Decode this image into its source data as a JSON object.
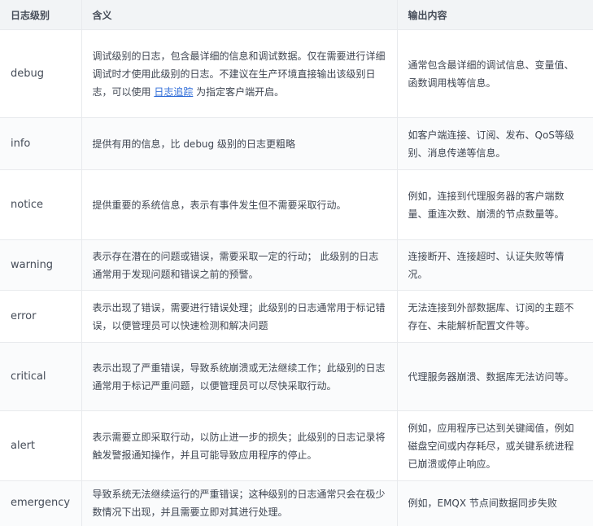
{
  "headers": [
    "日志级别",
    "含义",
    "输出内容"
  ],
  "rows": [
    {
      "level": "debug",
      "meaning_pre": "调试级别的日志，包含最详细的信息和调试数据。仅在需要进行详细调试时才使用此级别的日志。不建议在生产环境直接输出该级别日志，可以使用 ",
      "meaning_link": "日志追踪",
      "meaning_post": " 为指定客户端开启。",
      "output": "通常包含最详细的调试信息、变量值、函数调用栈等信息。"
    },
    {
      "level": "info",
      "meaning": "提供有用的信息，比 debug 级别的日志更粗略",
      "output": "如客户端连接、订阅、发布、QoS等级别、消息传递等信息。"
    },
    {
      "level": "notice",
      "meaning": "提供重要的系统信息，表示有事件发生但不需要采取行动。",
      "output": "例如，连接到代理服务器的客户端数量、重连次数、崩溃的节点数量等。"
    },
    {
      "level": "warning",
      "meaning": "表示存在潜在的问题或错误，需要采取一定的行动； 此级别的日志通常用于发现问题和错误之前的预警。",
      "output": "连接断开、连接超时、认证失败等情况。"
    },
    {
      "level": "error",
      "meaning": "表示出现了错误，需要进行错误处理；此级别的日志通常用于标记错误，以便管理员可以快速检测和解决问题",
      "output": "无法连接到外部数据库、订阅的主题不存在、未能解析配置文件等。"
    },
    {
      "level": "critical",
      "meaning": "表示出现了严重错误，导致系统崩溃或无法继续工作；此级别的日志通常用于标记严重问题，以便管理员可以尽快采取行动。",
      "output": "代理服务器崩溃、数据库无法访问等。"
    },
    {
      "level": "alert",
      "meaning": "表示需要立即采取行动，以防止进一步的损失；此级别的日志记录将触发警报通知操作，并且可能导致应用程序的停止。",
      "output": "例如，应用程序已达到关键阈值，例如磁盘空间或内存耗尽，或关键系统进程已崩溃或停止响应。"
    },
    {
      "level": "emergency",
      "meaning": "导致系统无法继续运行的严重错误；这种级别的日志通常只会在极少数情况下出现，并且需要立即对其进行处理。",
      "output": "例如，EMQX 节点间数据同步失败"
    }
  ]
}
